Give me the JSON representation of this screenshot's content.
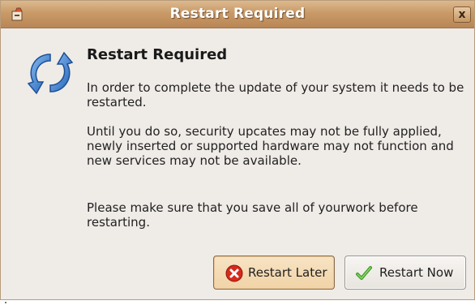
{
  "window": {
    "title": "Restart Required",
    "close_glyph": "x"
  },
  "dialog": {
    "heading": "Restart Required",
    "paragraph1": "In order to complete the update of your system it needs to be restarted.",
    "paragraph2": "Until you do so, security upcates may not be fully applied, newly inserted or supported hardware may not function and new services may not be available.",
    "paragraph3": "Please make sure that you save all of yourwork before restarting.",
    "icon": "restart-arrows-icon"
  },
  "buttons": {
    "restart_later": {
      "label": "Restart Later",
      "icon": "red-x-icon"
    },
    "restart_now": {
      "label": "Restart Now",
      "icon": "green-check-icon"
    }
  },
  "colors": {
    "titlebar": "#c99a68",
    "dialog_bg": "#efebe7",
    "restart_later_bg": "#f1d3a6",
    "icon_blue": "#2e6fc4"
  }
}
